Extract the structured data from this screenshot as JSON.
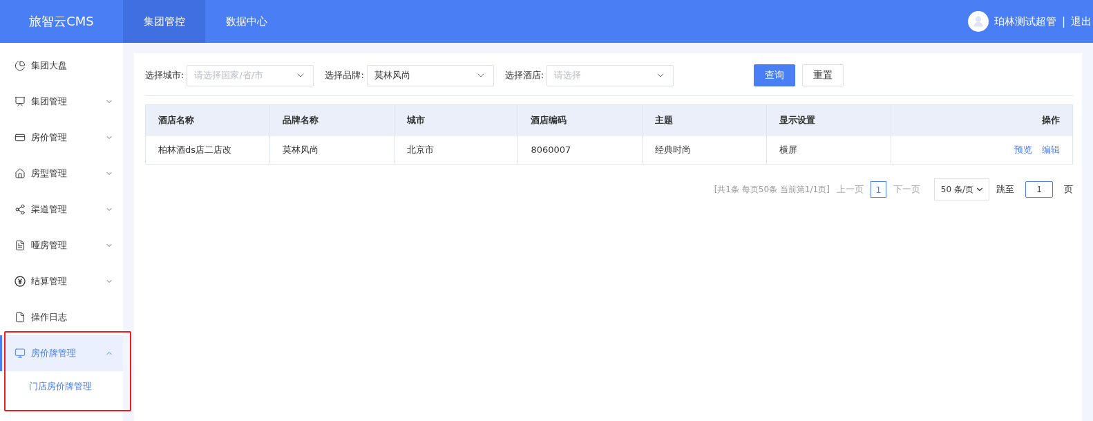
{
  "header": {
    "logo": "旅智云CMS",
    "tabs": [
      {
        "label": "集团管控",
        "selected": true
      },
      {
        "label": "数据中心",
        "selected": false
      }
    ],
    "user": {
      "name": "珀林测试超管",
      "separator": "|",
      "logout": "退出"
    }
  },
  "sidebar": {
    "items": [
      {
        "kind": "link",
        "label": "集团大盘",
        "selected": false
      },
      {
        "kind": "group",
        "label": "集团管理",
        "expanded": false,
        "selected": false
      },
      {
        "kind": "group",
        "label": "房价管理",
        "expanded": false,
        "selected": false
      },
      {
        "kind": "group",
        "label": "房型管理",
        "expanded": false,
        "selected": false
      },
      {
        "kind": "group",
        "label": "渠道管理",
        "expanded": false,
        "selected": false
      },
      {
        "kind": "group",
        "label": "哑房管理",
        "expanded": false,
        "selected": false
      },
      {
        "kind": "group",
        "label": "结算管理",
        "expanded": false,
        "selected": false
      },
      {
        "kind": "link",
        "label": "操作日志",
        "selected": false
      },
      {
        "kind": "group",
        "label": "房价牌管理",
        "expanded": true,
        "selected": true,
        "highlighted": true,
        "children": [
          {
            "label": "门店房价牌管理",
            "selected": true
          }
        ]
      }
    ]
  },
  "filters": [
    {
      "label": "选择城市:",
      "placeholder": "请选择国家/省/市"
    },
    {
      "label": "选择品牌:",
      "value": "莫林风尚"
    },
    {
      "label": "选择酒店:",
      "placeholder": "请选择"
    }
  ],
  "buttons": [
    {
      "kind": "primary",
      "label": "查询"
    },
    {
      "kind": "default",
      "label": "重置"
    }
  ],
  "table": {
    "columns": [
      "酒店名称",
      "品牌名称",
      "城市",
      "酒店编码",
      "主题",
      "显示设置",
      "操作"
    ],
    "rows": [
      {
        "cells": [
          "柏林酒ds店二店改",
          "莫林风尚",
          "北京市",
          "8060007",
          "经典时尚",
          "横屏"
        ],
        "actions": [
          "预览",
          "编辑"
        ]
      }
    ]
  },
  "pagination": {
    "summary": "[共1条 每页50条 当前第1/1页]",
    "prev": {
      "label": "上一页",
      "disabled": true
    },
    "pages": [
      {
        "label": "1",
        "selected": true
      }
    ],
    "next": {
      "label": "下一页",
      "disabled": true
    },
    "page_size": "50 条/页",
    "jump_label": "跳至",
    "jump_value": "1",
    "jump_suffix": "页"
  }
}
